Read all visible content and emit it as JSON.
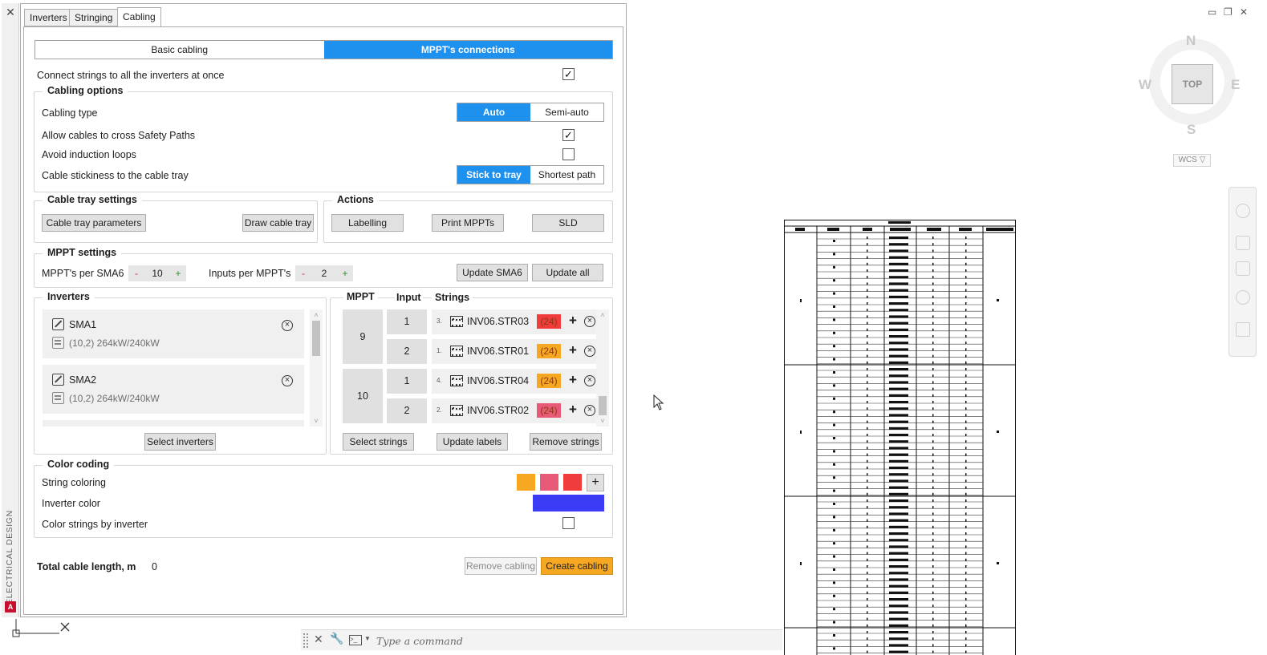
{
  "palette": {
    "title": "ELECTRICAL DESIGN",
    "close_glyph": "✕",
    "logo_letter": "A"
  },
  "tabs": [
    {
      "label": "Inverters",
      "active": false
    },
    {
      "label": "Stringing",
      "active": false
    },
    {
      "label": "Cabling",
      "active": true
    }
  ],
  "mode": {
    "basic_label": "Basic cabling",
    "mppt_label": "MPPT's connections",
    "active": "mppt"
  },
  "connect_all": {
    "label": "Connect strings to all the inverters at once",
    "checked": true
  },
  "cabling_options": {
    "title": "Cabling options",
    "cabling_type": {
      "label": "Cabling type",
      "options": [
        "Auto",
        "Semi-auto"
      ],
      "selected": "Auto"
    },
    "allow_cross": {
      "label": "Allow cables to cross Safety Paths",
      "checked": true
    },
    "avoid_loops": {
      "label": "Avoid induction loops",
      "checked": false
    },
    "stickiness": {
      "label": "Cable stickiness to the cable tray",
      "options": [
        "Stick to tray",
        "Shortest path"
      ],
      "selected": "Stick to tray"
    }
  },
  "cable_tray": {
    "title": "Cable tray settings",
    "params_button": "Cable tray parameters",
    "draw_button": "Draw cable tray"
  },
  "actions": {
    "title": "Actions",
    "labelling": "Labelling",
    "print_mppts": "Print MPPTs",
    "sld": "SLD"
  },
  "mppt_settings": {
    "title": "MPPT settings",
    "per_sma_label": "MPPT's per SMA6",
    "per_sma_value": "10",
    "inputs_label": "Inputs per MPPT's",
    "inputs_value": "2",
    "minus": "-",
    "plus": "+",
    "update_sma": "Update SMA6",
    "update_all": "Update all"
  },
  "inverters": {
    "title": "Inverters",
    "items": [
      {
        "name": "SMA1",
        "info": "(10,2)  264kW/240kW"
      },
      {
        "name": "SMA2",
        "info": "(10,2)  264kW/240kW"
      }
    ],
    "select_button": "Select inverters"
  },
  "mppt_grid": {
    "headers": {
      "mppt": "MPPT",
      "input": "Input",
      "strings": "Strings"
    },
    "groups": [
      {
        "mppt": "9",
        "rows": [
          {
            "input": "1",
            "index": "3.",
            "string": "INV06.STR03",
            "count": "(24)",
            "color": "#f03c3c"
          },
          {
            "input": "2",
            "index": "1.",
            "string": "INV06.STR01",
            "count": "(24)",
            "color": "#f7a823"
          }
        ]
      },
      {
        "mppt": "10",
        "rows": [
          {
            "input": "1",
            "index": "4.",
            "string": "INV06.STR04",
            "count": "(24)",
            "color": "#f7a823"
          },
          {
            "input": "2",
            "index": "2.",
            "string": "INV06.STR02",
            "count": "(24)",
            "color": "#e85a78"
          }
        ]
      }
    ],
    "select_strings": "Select strings",
    "update_labels": "Update labels",
    "remove_strings": "Remove strings"
  },
  "color_coding": {
    "title": "Color coding",
    "string_coloring_label": "String coloring",
    "swatches": [
      "#f7a823",
      "#e85a78",
      "#f03c3c"
    ],
    "add_glyph": "+",
    "inverter_color_label": "Inverter color",
    "inverter_color": "#3b3bf5",
    "by_inverter": {
      "label": "Color strings by inverter",
      "checked": false
    }
  },
  "footer": {
    "total_label": "Total cable length, m",
    "total_value": "0",
    "remove_cabling": "Remove cabling",
    "create_cabling": "Create cabling"
  },
  "cad": {
    "window_controls": [
      "▭",
      "❐",
      "✕"
    ],
    "compass": {
      "n": "N",
      "s": "S",
      "e": "E",
      "w": "W"
    },
    "viewcube_label": "TOP",
    "wcs_label": "WCS ▽",
    "command_placeholder": "Type a command"
  }
}
